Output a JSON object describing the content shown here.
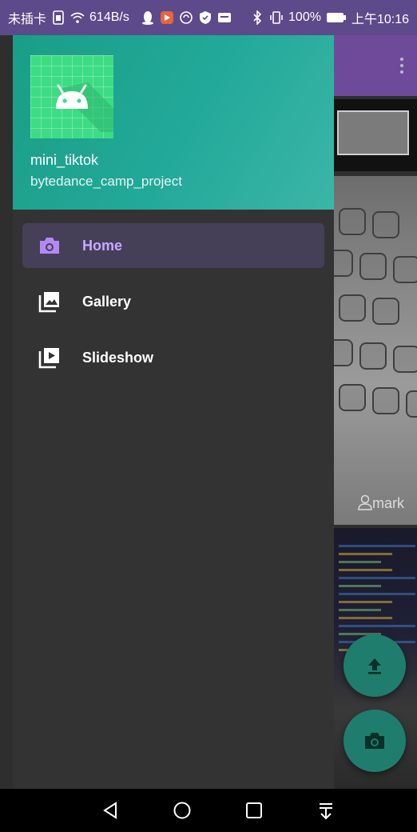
{
  "status_bar": {
    "carrier": "未插卡",
    "speed": "614B/s",
    "battery": "100%",
    "time": "上午10:16"
  },
  "drawer": {
    "header": {
      "title": "mini_tiktok",
      "subtitle": "bytedance_camp_project"
    },
    "items": [
      {
        "label": "Home",
        "icon": "camera-icon",
        "active": true
      },
      {
        "label": "Gallery",
        "icon": "photo-library-icon",
        "active": false
      },
      {
        "label": "Slideshow",
        "icon": "slideshow-icon",
        "active": false
      }
    ]
  },
  "background": {
    "card_caption": "mark"
  },
  "colors": {
    "status_bar": "#5c4a8a",
    "drawer_header": "#23a99a",
    "drawer_bg": "#333333",
    "active_item": "#463f58",
    "active_label": "#c9a8ff",
    "fab": "#1f7d6e"
  }
}
